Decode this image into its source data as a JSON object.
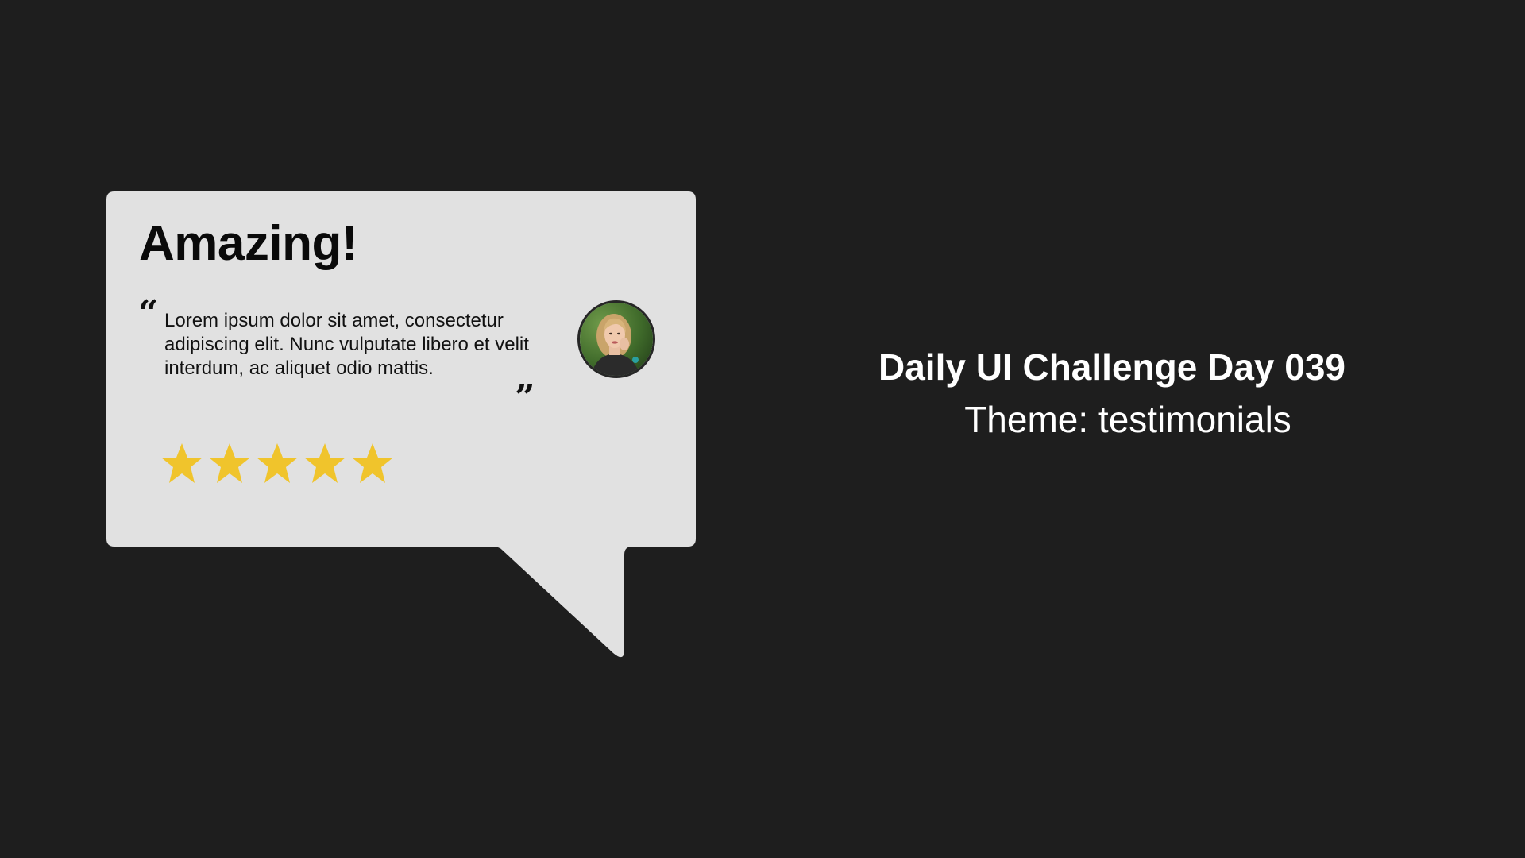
{
  "colors": {
    "background": "#1e1e1e",
    "bubble": "#e1e1e1",
    "star": "#f0c42c",
    "text_dark": "#0a0a0a",
    "text_light": "#ffffff"
  },
  "testimonial": {
    "headline": "Amazing!",
    "quote_open": "“",
    "quote_close": "„",
    "quote": "Lorem ipsum dolor sit amet, consectetur adipiscing elit. Nunc vulputate libero et velit interdum, ac aliquet odio mattis.",
    "avatar_icon": "user-photo-avatar",
    "rating": {
      "value": 5,
      "max": 5,
      "icon": "star-icon"
    }
  },
  "caption": {
    "title": "Daily UI Challenge Day 039",
    "subtitle": "Theme: testimonials"
  }
}
